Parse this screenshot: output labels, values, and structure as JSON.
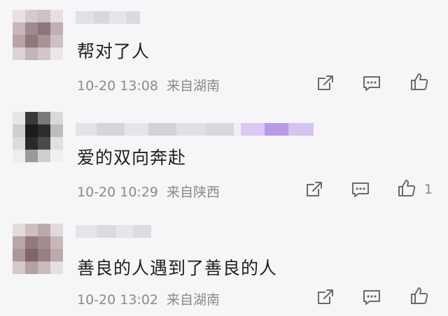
{
  "comments": [
    {
      "text": "帮对了人",
      "time": "10-20 13:08",
      "location": "来自湖南",
      "like_count": ""
    },
    {
      "text": "爱的双向奔赴",
      "time": "10-20 10:29",
      "location": "来自陕西",
      "like_count": "1"
    },
    {
      "text": "善良的人遇到了善良的人",
      "time": "10-20 13:02",
      "location": "来自湖南",
      "like_count": ""
    }
  ],
  "icons": {
    "share": "share-icon",
    "reply": "comment-icon",
    "like": "thumbs-up-icon"
  },
  "colors": {
    "background": "#f6f5f8",
    "text": "#1f1f1f",
    "meta": "#8a8a8a",
    "icon": "#6a6a6a"
  }
}
